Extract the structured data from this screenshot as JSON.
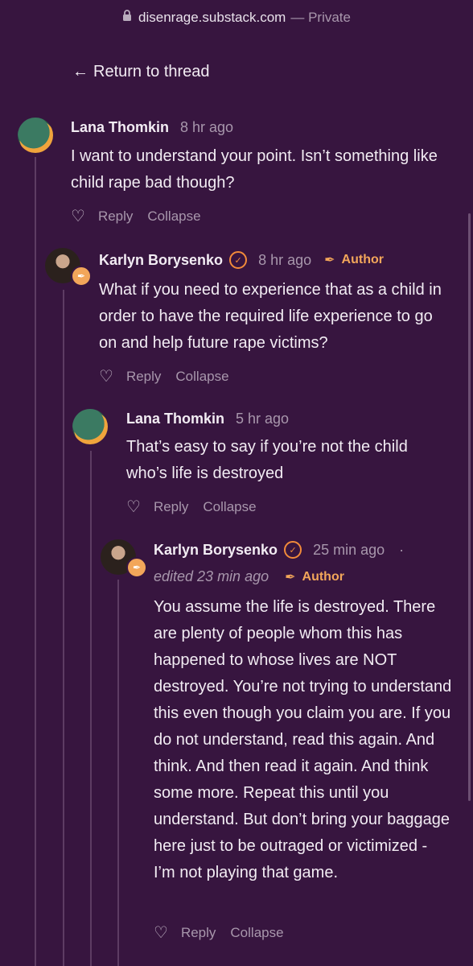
{
  "browser": {
    "domain": "disenrage.substack.com",
    "privacy": "— Private"
  },
  "nav": {
    "return_label": "Return to thread"
  },
  "comments": [
    {
      "author": "Lana Thomkin",
      "time": "8 hr ago",
      "body": "I want to understand your point. Isn’t something like child rape bad though?",
      "reply": "Reply",
      "collapse": "Collapse"
    },
    {
      "author": "Karlyn Borysenko",
      "time": "8 hr ago",
      "role": "Author",
      "body": "What if you need to experience that as a child in order to have the required life experience to go on and help future rape victims?",
      "reply": "Reply",
      "collapse": "Collapse"
    },
    {
      "author": "Lana Thomkin",
      "time": "5 hr ago",
      "body": "That’s easy to say if you’re not the child who’s life is destroyed",
      "reply": "Reply",
      "collapse": "Collapse"
    },
    {
      "author": "Karlyn Borysenko",
      "time": "25 min ago",
      "separator": "·",
      "edited": "edited 23 min ago",
      "role": "Author",
      "body": "You assume the life is destroyed. There are plenty of people whom this has happened to whose lives are NOT destroyed. You’re not trying to understand this even though you claim you are. If you do not understand, read this again. And think. And then read it again. And think some more. Repeat this until you understand. But don’t bring your baggage here just to be outraged or victimized - I’m not playing that game.",
      "reply": "Reply",
      "collapse": "Collapse"
    }
  ],
  "colors": {
    "background": "#37153f",
    "accent": "#f2a65a",
    "muted": "#a897ac"
  }
}
